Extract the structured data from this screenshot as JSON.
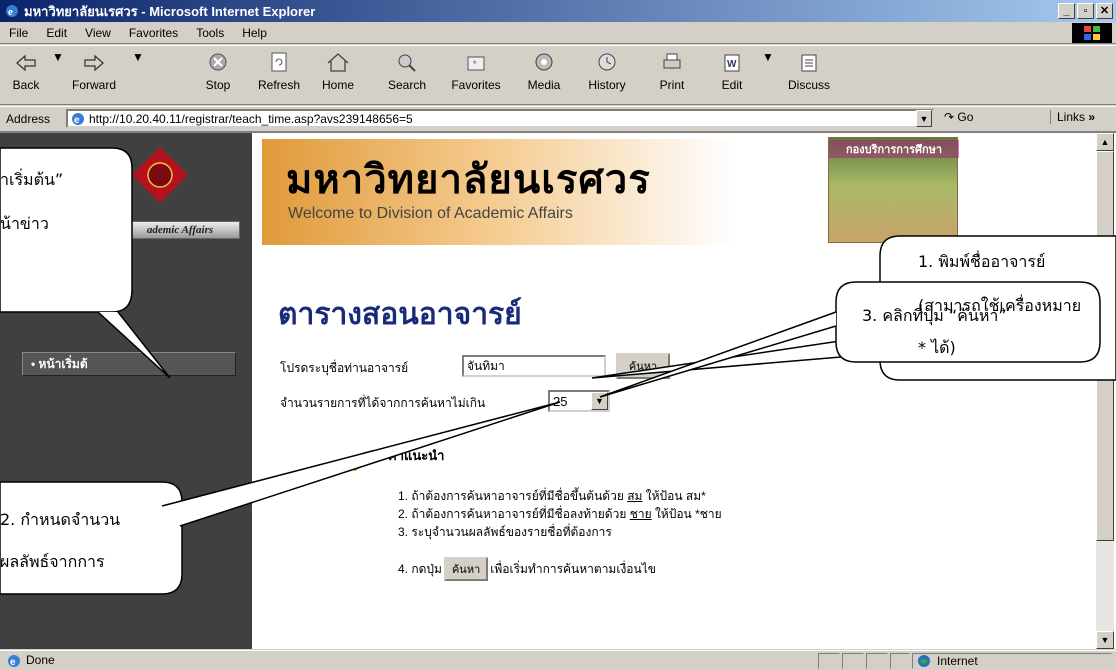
{
  "window": {
    "title": "มหาวิทยาลัยนเรศวร - Microsoft Internet Explorer",
    "buttons": {
      "minimize": "_",
      "maximize": "▫",
      "close": "✕"
    }
  },
  "menu": [
    "File",
    "Edit",
    "View",
    "Favorites",
    "Tools",
    "Help"
  ],
  "toolbar": {
    "back": "Back",
    "forward": "Forward",
    "stop": "Stop",
    "refresh": "Refresh",
    "home": "Home",
    "search": "Search",
    "favorites": "Favorites",
    "media": "Media",
    "history": "History",
    "print": "Print",
    "edit": "Edit",
    "discuss": "Discuss"
  },
  "address": {
    "label": "Address",
    "url": "http://10.20.40.11/registrar/teach_time.asp?avs239148656=5",
    "go": "Go",
    "links": "Links"
  },
  "sidebar": {
    "banner": "ademic Affairs",
    "home_item": "• หน้าเริ่มต้"
  },
  "header": {
    "university": "มหาวิทยาลัยนเรศวร",
    "welcome": "Welcome to Division of Academic Affairs",
    "photo_caption": "กองบริการการศึกษา"
  },
  "page": {
    "title": "ตารางสอนอาจารย์",
    "name_label": "โปรดระบุชื่อท่านอาจารย์",
    "name_value": "จันทิมา",
    "search_button": "ค้นหา",
    "limit_label": "จำนวนรายการที่ได้จากการค้นหาไม่เกิน",
    "limit_value": "25",
    "instructions_title": "คำแนะนำ",
    "instr1_pre": "1. ถ้าต้องการค้นหาอาจารย์ที่มีชื่อขึ้นต้นด้วย ",
    "instr1_u": "สม",
    "instr1_post": " ให้ป้อน สม*",
    "instr2_pre": "2. ถ้าต้องการค้นหาอาจารย์ที่มีชื่อลงท้ายด้วย ",
    "instr2_u": "ชาย",
    "instr2_post": " ให้ป้อน *ชาย",
    "instr3": "3. ระบุจำนวนผลลัพธ์ของรายชื่อที่ต้องการ",
    "instr4_pre": "4. กดปุ่ม",
    "instr4_btn": "ค้นหา",
    "instr4_post": "เพื่อเริ่มทำการค้นหาตามเงื่อนไข"
  },
  "callouts": {
    "top_left_1": "ำเริ่มต้น”",
    "top_left_2": "น้าข่าว",
    "step1_1": "1. พิมพ์ชื่ออาจารย์",
    "step1_2": "(สามารถใช้เครื่องหมาย",
    "step1_3": "*  ได้)",
    "step2_1": "2. กำหนดจำนวน",
    "step2_2": "ผลลัพธ์จากการ",
    "step3": "3. คลิกที่ปุ่ม “ค้นหา”"
  },
  "status": {
    "text": "Done",
    "zone": "Internet"
  }
}
